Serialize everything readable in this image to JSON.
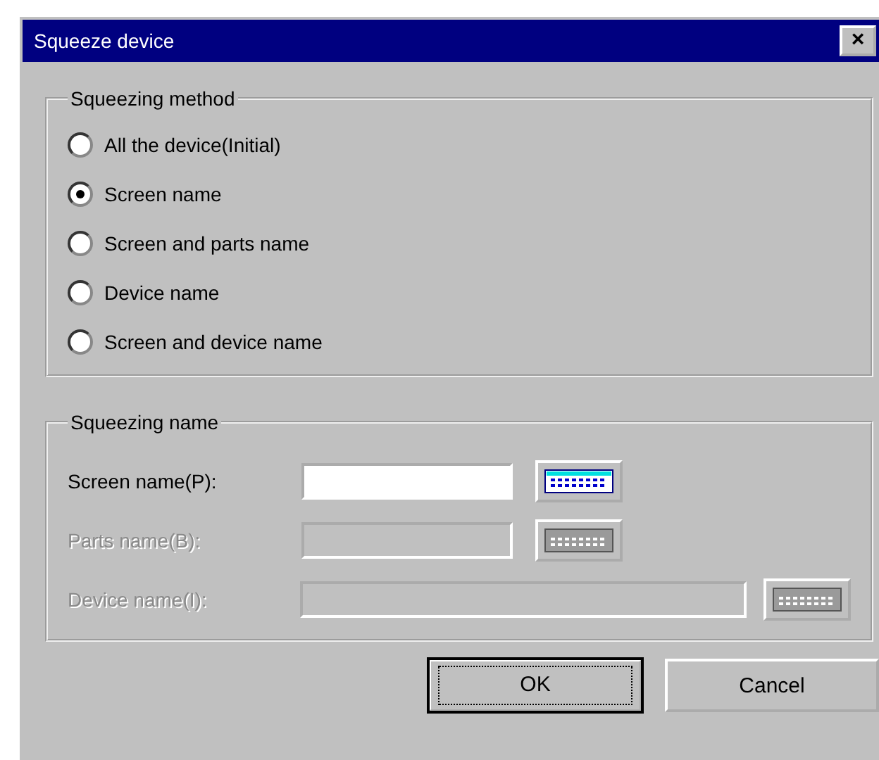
{
  "window": {
    "title": "Squeeze device",
    "close": "×"
  },
  "method_group": {
    "title": "Squeezing method",
    "options": [
      {
        "label": "All the device(Initial)",
        "selected": false
      },
      {
        "label": "Screen name",
        "selected": true
      },
      {
        "label": "Screen and parts name",
        "selected": false
      },
      {
        "label": "Device name",
        "selected": false
      },
      {
        "label": "Screen and device name",
        "selected": false
      }
    ]
  },
  "name_group": {
    "title": "Squeezing name",
    "fields": [
      {
        "label": "Screen name(P):",
        "disabled": false,
        "kind": "short"
      },
      {
        "label": "Parts name(B):",
        "disabled": true,
        "kind": "short"
      },
      {
        "label": "Device name(I):",
        "disabled": true,
        "kind": "long"
      }
    ]
  },
  "buttons": [
    {
      "label": "OK",
      "default": true
    },
    {
      "label": "Cancel",
      "default": false
    }
  ]
}
